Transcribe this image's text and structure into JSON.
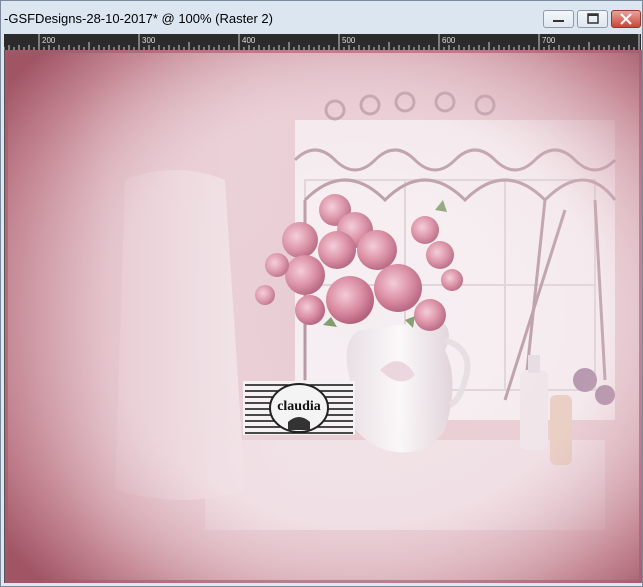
{
  "window": {
    "title": "-GSFDesigns-28-10-2017* @ 100% (Raster 2)",
    "buttons": {
      "minimize": "minimize-icon",
      "maximize": "maximize-icon",
      "close": "close-icon"
    }
  },
  "ruler": {
    "labels": [
      "200",
      "300",
      "400",
      "500",
      "600",
      "700"
    ]
  },
  "canvas": {
    "watermark_text": "claudia",
    "colors": {
      "frame": "#a8606e",
      "background": "#e2bcc4",
      "roses": "#d68aa6",
      "pitcher": "#f3f0f2"
    }
  }
}
